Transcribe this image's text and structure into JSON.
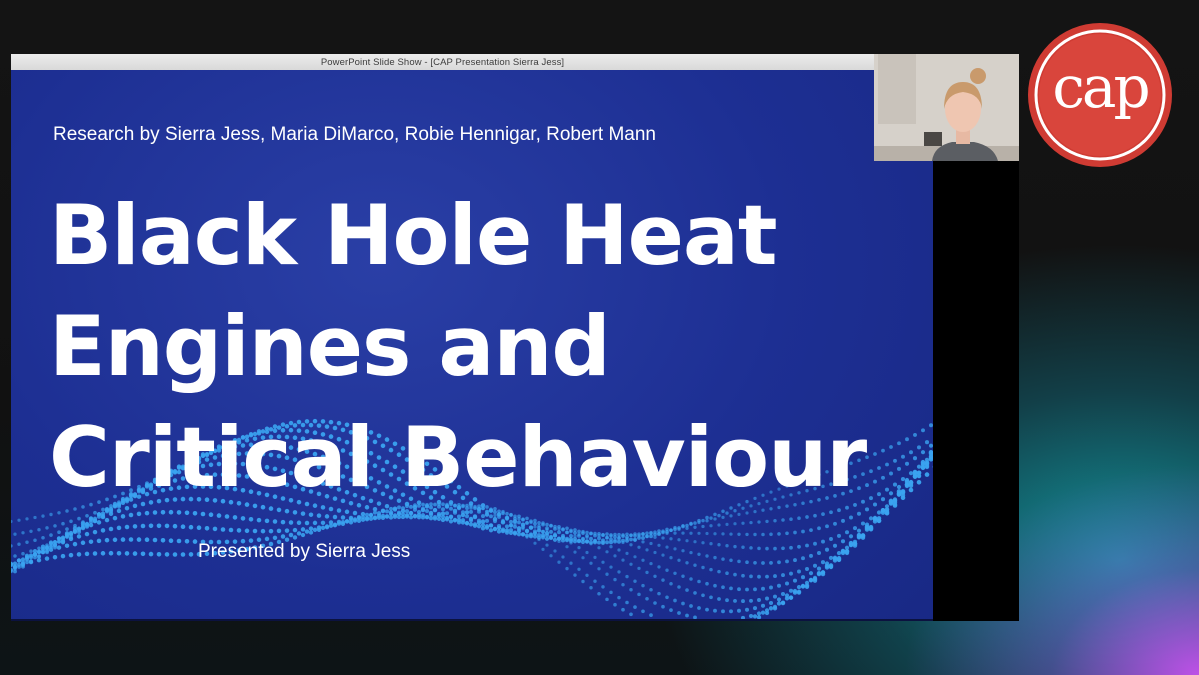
{
  "window": {
    "title": "PowerPoint Slide Show - [CAP Presentation Sierra Jess]"
  },
  "slide": {
    "authors": "Research by Sierra Jess, Maria DiMarco, Robie Hennigar, Robert Mann",
    "title_lines": [
      "Black Hole Heat",
      "Engines and",
      "Critical Behaviour"
    ],
    "presenter": "Presented by Sierra Jess"
  },
  "webcam": {
    "label": "presenter-webcam"
  },
  "logo": {
    "text": "cap",
    "color": "#d9453c"
  },
  "colors": {
    "slide_background": "#1d2f93",
    "wave_dots": "#3aa3f0",
    "slide_text": "#ffffff"
  }
}
